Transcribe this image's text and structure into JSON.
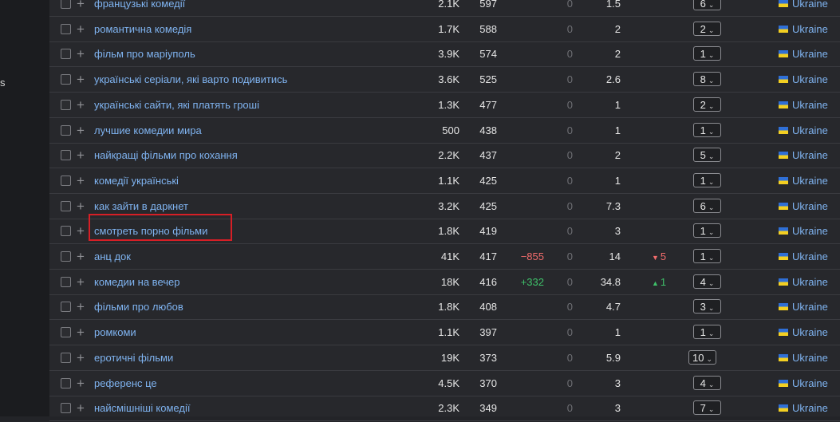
{
  "sidebar": {
    "glyph": "s"
  },
  "country_label": "Ukraine",
  "rows": [
    {
      "keyword": "французькі комедії",
      "volume": "2.1K",
      "traffic": "597",
      "change": "",
      "zero": "0",
      "kd": "1.5",
      "pos_change": "",
      "pos_dir": "",
      "position": "6"
    },
    {
      "keyword": "романтична комедія",
      "volume": "1.7K",
      "traffic": "588",
      "change": "",
      "zero": "0",
      "kd": "2",
      "pos_change": "",
      "pos_dir": "",
      "position": "2"
    },
    {
      "keyword": "фільм про маріуполь",
      "volume": "3.9K",
      "traffic": "574",
      "change": "",
      "zero": "0",
      "kd": "2",
      "pos_change": "",
      "pos_dir": "",
      "position": "1"
    },
    {
      "keyword": "українські серіали, які варто подивитись",
      "volume": "3.6K",
      "traffic": "525",
      "change": "",
      "zero": "0",
      "kd": "2.6",
      "pos_change": "",
      "pos_dir": "",
      "position": "8"
    },
    {
      "keyword": "українські сайти, які платять гроші",
      "volume": "1.3K",
      "traffic": "477",
      "change": "",
      "zero": "0",
      "kd": "1",
      "pos_change": "",
      "pos_dir": "",
      "position": "2"
    },
    {
      "keyword": "лучшие комедии мира",
      "volume": "500",
      "traffic": "438",
      "change": "",
      "zero": "0",
      "kd": "1",
      "pos_change": "",
      "pos_dir": "",
      "position": "1"
    },
    {
      "keyword": "найкращі фільми про кохання",
      "volume": "2.2K",
      "traffic": "437",
      "change": "",
      "zero": "0",
      "kd": "2",
      "pos_change": "",
      "pos_dir": "",
      "position": "5"
    },
    {
      "keyword": "комедії українські",
      "volume": "1.1K",
      "traffic": "425",
      "change": "",
      "zero": "0",
      "kd": "1",
      "pos_change": "",
      "pos_dir": "",
      "position": "1"
    },
    {
      "keyword": "как зайти в даркнет",
      "volume": "3.2K",
      "traffic": "425",
      "change": "",
      "zero": "0",
      "kd": "7.3",
      "pos_change": "",
      "pos_dir": "",
      "position": "6"
    },
    {
      "keyword": "смотреть порно фільми",
      "volume": "1.8K",
      "traffic": "419",
      "change": "",
      "zero": "0",
      "kd": "3",
      "pos_change": "",
      "pos_dir": "",
      "position": "1",
      "highlighted": true
    },
    {
      "keyword": "анц док",
      "volume": "41K",
      "traffic": "417",
      "change": "−855",
      "change_dir": "neg",
      "zero": "0",
      "kd": "14",
      "pos_change": "5",
      "pos_dir": "neg",
      "position": "1"
    },
    {
      "keyword": "комедии на вечер",
      "volume": "18K",
      "traffic": "416",
      "change": "+332",
      "change_dir": "pos",
      "zero": "0",
      "kd": "34.8",
      "pos_change": "1",
      "pos_dir": "pos",
      "position": "4"
    },
    {
      "keyword": "фільми про любов",
      "volume": "1.8K",
      "traffic": "408",
      "change": "",
      "zero": "0",
      "kd": "4.7",
      "pos_change": "",
      "pos_dir": "",
      "position": "3"
    },
    {
      "keyword": "ромкоми",
      "volume": "1.1K",
      "traffic": "397",
      "change": "",
      "zero": "0",
      "kd": "1",
      "pos_change": "",
      "pos_dir": "",
      "position": "1"
    },
    {
      "keyword": "еротичні фільми",
      "volume": "19K",
      "traffic": "373",
      "change": "",
      "zero": "0",
      "kd": "5.9",
      "pos_change": "",
      "pos_dir": "",
      "position": "10"
    },
    {
      "keyword": "референс це",
      "volume": "4.5K",
      "traffic": "370",
      "change": "",
      "zero": "0",
      "kd": "3",
      "pos_change": "",
      "pos_dir": "",
      "position": "4"
    },
    {
      "keyword": "найсмішніші комедії",
      "volume": "2.3K",
      "traffic": "349",
      "change": "",
      "zero": "0",
      "kd": "3",
      "pos_change": "",
      "pos_dir": "",
      "position": "7"
    }
  ],
  "colors": {
    "background": "#27282c",
    "link": "#7fb3f0",
    "negative": "#f26c6c",
    "positive": "#3fc26a",
    "highlight": "#d61f26"
  }
}
